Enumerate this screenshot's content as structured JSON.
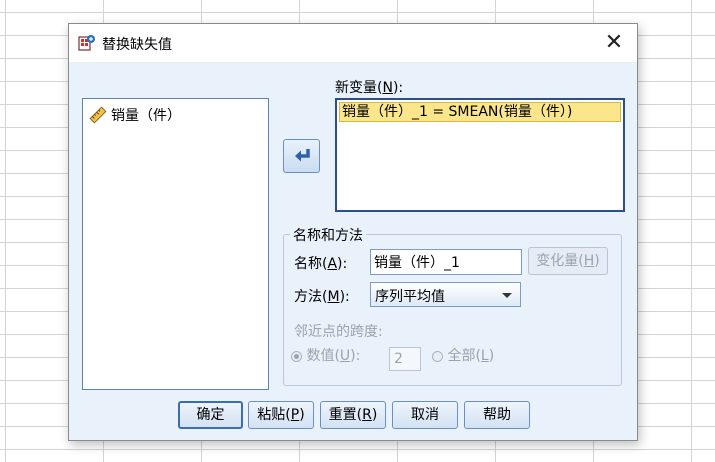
{
  "dialog": {
    "title": "替换缺失值",
    "close_label": "✕"
  },
  "source_list": {
    "items": [
      {
        "label": "销量（件）",
        "icon": "ruler-icon"
      }
    ]
  },
  "target": {
    "label": "新变量",
    "shortcut": "N",
    "items": [
      "销量（件）_1 = SMEAN(销量（件）)"
    ]
  },
  "method_group": {
    "title": "名称和方法",
    "name_label": "名称",
    "name_shortcut": "A",
    "name_value": "销量（件）_1",
    "change_label": "变化量",
    "change_shortcut": "H",
    "method_label": "方法",
    "method_shortcut": "M",
    "method_value": "序列平均值",
    "span_label": "邻近点的跨度:",
    "value_option_label": "数值",
    "value_option_shortcut": "U",
    "span_value": "2",
    "all_option_label": "全部",
    "all_option_shortcut": "L"
  },
  "buttons": {
    "ok": "确定",
    "paste": "粘贴",
    "paste_shortcut": "P",
    "reset": "重置",
    "reset_shortcut": "R",
    "cancel": "取消",
    "help": "帮助"
  },
  "colors": {
    "dialog_bg": "#e9f1fb",
    "selection": "#fbe68c",
    "arrow": "#2f5fa8"
  }
}
